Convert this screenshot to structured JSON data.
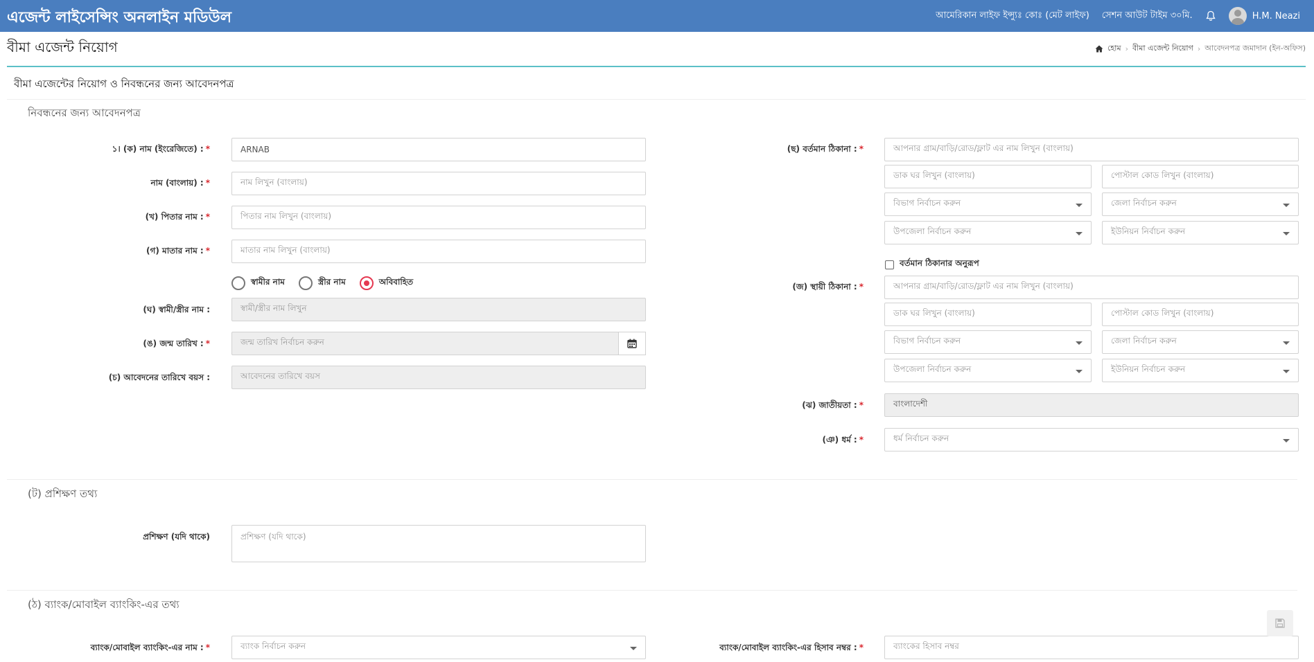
{
  "header": {
    "brand": "এজেন্ট লাইসেন্সিং অনলাইন মডিউল",
    "company": "আমেরিকান লাইফ ইন্স্যুঃ কোঃ (মেট লাইফ)",
    "session": "সেশন আউট টাইম ৩০মি.",
    "user_name": "H.M. Neazi"
  },
  "page": {
    "title": "বীমা এজেন্ট নিয়োগ",
    "breadcrumb": [
      "হোম",
      "বীমা এজেন্ট নিয়োগ",
      "আবেদনপত্র জমাদান (ইন-অফিস)"
    ]
  },
  "form": {
    "card_title": "বীমা এজেন্টের নিয়োগ ও নিবন্ধনের জন্য আবেদনপত্র",
    "section_registration": "নিবন্ধনের জন্য আবেদনপত্র",
    "left": {
      "name_en_label": "১। (ক) নাম (ইংরেজিতে) :",
      "name_en_value": "ARNAB",
      "name_bn_label": "নাম (বাংলায়) :",
      "name_bn_placeholder": "নাম লিখুন (বাংলায়)",
      "father_label": "(খ) পিতার নাম :",
      "father_placeholder": "পিতার নাম লিখুন (বাংলায়)",
      "mother_label": "(গ) মাতার নাম :",
      "mother_placeholder": "মাতার নাম লিখুন (বাংলায়)",
      "marital_options": [
        "স্বামীর নাম",
        "স্ত্রীর নাম",
        "অবিবাহিত"
      ],
      "marital_selected": "অবিবাহিত",
      "spouse_label": "(ঘ) স্বামী/স্ত্রীর নাম :",
      "spouse_placeholder": "স্বামী/স্ত্রীর নাম লিখুন",
      "dob_label": "(ঙ) জন্ম তারিখ :",
      "dob_placeholder": "জন্ম তারিখ নির্বাচন করুন",
      "age_label": "(চ) আবেদনের তারিখে বয়স :",
      "age_placeholder": "আবেদনের তারিখে বয়স"
    },
    "right": {
      "present_label": "(ছ) বর্তমান ঠিকানা :",
      "address_placeholder": "আপনার গ্রাম/বাড়ি/রোড/ফ্লাট এর নাম লিখুন (বাংলায়)",
      "post_office_placeholder": "ডাক ঘর লিখুন (বাংলায়)",
      "postal_code_placeholder": "পোস্টাল কোড লিখুন (বাংলায়)",
      "division_placeholder": "বিভাগ নির্বাচন করুন",
      "district_placeholder": "জেলা নির্বাচন করুন",
      "upazila_placeholder": "উপজেলা নির্বাচন করুন",
      "union_placeholder": "ইউনিয়ন নির্বাচন করুন",
      "same_as_present": "বর্তমান ঠিকানার অনুরূপ",
      "permanent_label": "(জ) স্থায়ী ঠিকানা :",
      "nationality_label": "(ঝ) জাতীয়তা :",
      "nationality_value": "বাংলাদেশী",
      "religion_label": "(ঞ) ধর্ম :",
      "religion_placeholder": "ধর্ম নির্বাচন করুন"
    },
    "training": {
      "section_title": "(ট) প্রশিক্ষণ তথ্য",
      "label": "প্রশিক্ষণ (যদি থাকে)",
      "placeholder": "প্রশিক্ষণ (যদি থাকে)"
    },
    "bank": {
      "section_title": "(ঠ) ব্যাংক/মোবাইল ব্যাংকিং-এর তথ্য",
      "name_label": "ব্যাংক/মোবাইল ব্যাংকিং-এর নাম :",
      "name_placeholder": "ব্যাংক নির্বাচন করুন",
      "account_label": "ব্যাংক/মোবাইল ব্যাংকিং-এর হিসাব নম্বর :",
      "account_placeholder": "ব্যাংকের হিসাব নম্বর"
    }
  },
  "colors": {
    "header_bg": "#4a7ebf",
    "accent_line": "#5bc0c7",
    "required": "#d9282f",
    "radio_selected": "#e53850"
  },
  "icons": [
    "bell-icon",
    "avatar",
    "home-icon",
    "calendar-icon",
    "chevron-down-icon",
    "save-icon"
  ]
}
